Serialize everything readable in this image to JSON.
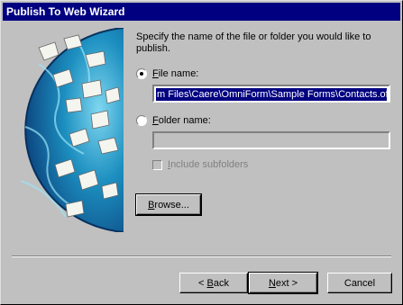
{
  "window": {
    "title": "Publish To Web Wizard"
  },
  "prompt": "Specify the name of the file or folder you would like to publish.",
  "options": {
    "file_name": {
      "label_key": "F",
      "label_rest": "ile name:",
      "checked": true,
      "value": "m Files\\Caere\\OmniForm\\Sample Forms\\Contacts.ofm"
    },
    "folder_name": {
      "label_key": "F",
      "label_rest": "older name:",
      "checked": false,
      "value": ""
    },
    "include_subfolders": {
      "label_key": "I",
      "label_rest": "nclude subfolders",
      "checked": false,
      "enabled": false
    }
  },
  "buttons": {
    "browse": {
      "key": "B",
      "rest": "rowse..."
    },
    "back": {
      "prefix": "< ",
      "key": "B",
      "rest": "ack"
    },
    "next": {
      "key": "N",
      "rest": "ext >"
    },
    "cancel": "Cancel"
  },
  "colors": {
    "titlebar": "#000080",
    "face": "#c0c0c0",
    "selection": "#000080"
  }
}
